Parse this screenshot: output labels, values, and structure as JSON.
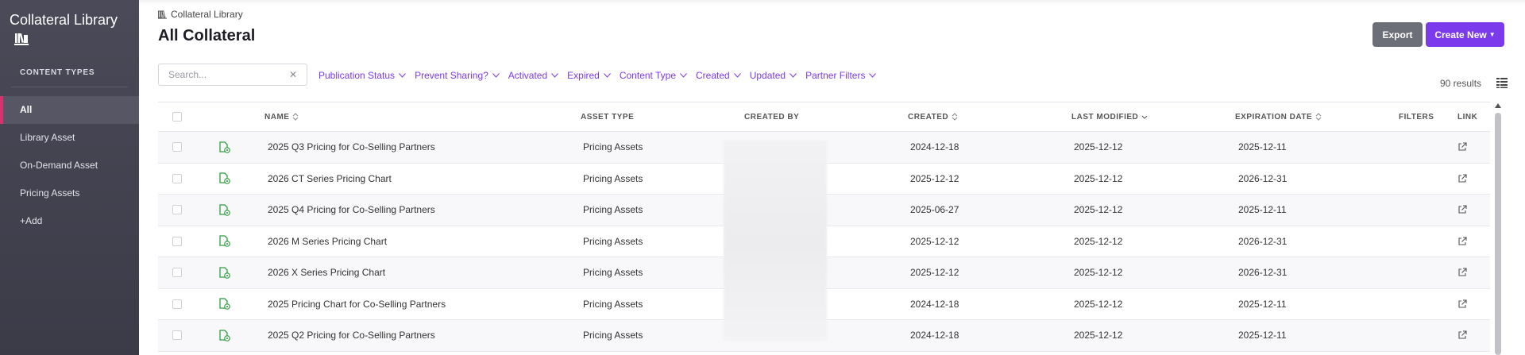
{
  "sidebar": {
    "title": "Collateral Library",
    "section_label": "CONTENT TYPES",
    "items": [
      {
        "label": "All",
        "active": true
      },
      {
        "label": "Library Asset"
      },
      {
        "label": "On-Demand Asset"
      },
      {
        "label": "Pricing Assets"
      },
      {
        "label": "+Add"
      }
    ]
  },
  "header": {
    "breadcrumb": "Collateral Library",
    "title": "All Collateral",
    "export_label": "Export",
    "create_label": "Create New"
  },
  "search": {
    "placeholder": "Search...",
    "value": ""
  },
  "filters": [
    "Publication Status",
    "Prevent Sharing?",
    "Activated",
    "Expired",
    "Content Type",
    "Created",
    "Updated",
    "Partner Filters"
  ],
  "results_text": "90 results",
  "table": {
    "columns": {
      "name": "NAME",
      "asset_type": "ASSET TYPE",
      "created_by": "CREATED BY",
      "created": "CREATED",
      "last_modified": "LAST MODIFIED",
      "expiration": "EXPIRATION DATE",
      "filters": "FILTERS",
      "link": "LINK"
    },
    "rows": [
      {
        "name": "2025 Q3 Pricing for Co-Selling Partners",
        "type": "Pricing Assets",
        "created": "2024-12-18",
        "modified": "2025-12-12",
        "expires": "2025-12-11"
      },
      {
        "name": "2026 CT Series Pricing Chart",
        "type": "Pricing Assets",
        "created": "2025-12-12",
        "modified": "2025-12-12",
        "expires": "2026-12-31"
      },
      {
        "name": "2025 Q4 Pricing for Co-Selling Partners",
        "type": "Pricing Assets",
        "created": "2025-06-27",
        "modified": "2025-12-12",
        "expires": "2025-12-11"
      },
      {
        "name": "2026 M Series Pricing Chart",
        "type": "Pricing Assets",
        "created": "2025-12-12",
        "modified": "2025-12-12",
        "expires": "2026-12-31"
      },
      {
        "name": "2026 X Series Pricing Chart",
        "type": "Pricing Assets",
        "created": "2025-12-12",
        "modified": "2025-12-12",
        "expires": "2026-12-31"
      },
      {
        "name": "2025 Pricing Chart for Co-Selling Partners",
        "type": "Pricing Assets",
        "created": "2024-12-18",
        "modified": "2025-12-12",
        "expires": "2025-12-11"
      },
      {
        "name": "2025 Q2 Pricing for Co-Selling Partners",
        "type": "Pricing Assets",
        "created": "2024-12-18",
        "modified": "2025-12-12",
        "expires": "2025-12-11"
      }
    ]
  },
  "colors": {
    "accent": "#7c3aed",
    "active_marker": "#d6336c",
    "file_icon": "#2e9e3e"
  },
  "icons": {
    "library": "library-icon",
    "file": "file-lock-icon",
    "link": "external-link-icon",
    "view": "list-view-icon"
  }
}
